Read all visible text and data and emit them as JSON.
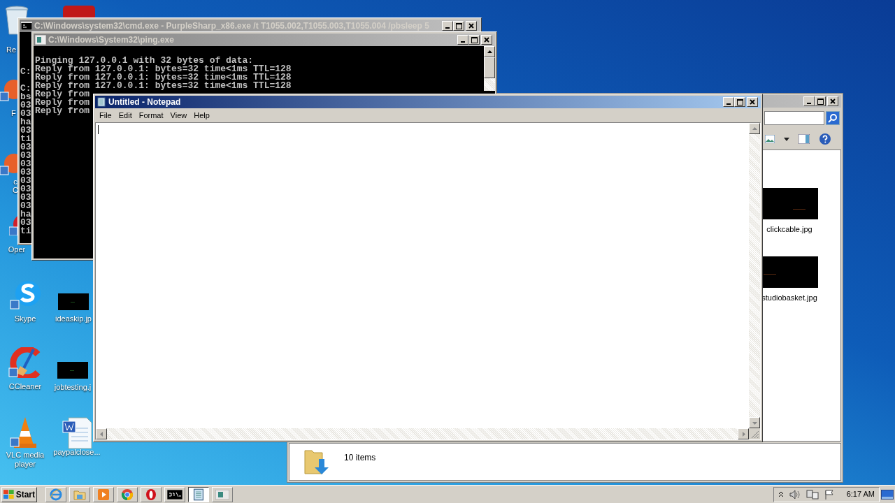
{
  "desktop_icons": [
    {
      "label": "Re",
      "kind": "recycle"
    },
    {
      "label": "F",
      "kind": "shortcut"
    },
    {
      "label": "c C",
      "kind": "shortcut"
    },
    {
      "label": "Oper",
      "kind": "opera"
    },
    {
      "label": "Skype",
      "kind": "skype"
    },
    {
      "label": "ideaskip.jp"
    },
    {
      "label": "CCleaner",
      "kind": "ccleaner"
    },
    {
      "label": "jobtesting.j"
    },
    {
      "label": "VLC media player",
      "kind": "vlc"
    },
    {
      "label": "paypalclose...",
      "kind": "word"
    }
  ],
  "cmd_window": {
    "title": "C:\\Windows\\system32\\cmd.exe - PurpleSharp_x86.exe  /t T1055.002,T1055.003,T1055.004 /pbsleep 5",
    "blocks": [
      [
        "C:"
      ],
      [
        "C:",
        "bs",
        "03",
        "03",
        "ha",
        "03",
        "ti",
        "03",
        "03",
        "03",
        "03",
        "03",
        "03",
        "03",
        "03",
        "ha",
        "03",
        "ti"
      ]
    ]
  },
  "ping_window": {
    "title": "C:\\Windows\\System32\\ping.exe",
    "lines": [
      "Pinging 127.0.0.1 with 32 bytes of data:",
      "Reply from 127.0.0.1: bytes=32 time<1ms TTL=128",
      "Reply from 127.0.0.1: bytes=32 time<1ms TTL=128",
      "Reply from 127.0.0.1: bytes=32 time<1ms TTL=128",
      "Reply from",
      "Reply from",
      "Reply from"
    ]
  },
  "explorer": {
    "files": [
      {
        "name": "clickcable.jpg",
        "kind": "picture"
      },
      {
        "name": "studiobasket.jpg",
        "kind": "picture"
      }
    ],
    "status": "10 items"
  },
  "notepad": {
    "title": "Untitled - Notepad",
    "menu": [
      "File",
      "Edit",
      "Format",
      "View",
      "Help"
    ]
  },
  "taskbar": {
    "start": "Start",
    "apps": [
      {
        "kind": "ie",
        "selected": false
      },
      {
        "kind": "folder",
        "selected": false
      },
      {
        "kind": "media",
        "selected": false
      },
      {
        "kind": "chrome",
        "selected": false
      },
      {
        "kind": "opera",
        "selected": false
      },
      {
        "kind": "console",
        "selected": false
      },
      {
        "kind": "notepad",
        "selected": true
      },
      {
        "kind": "window",
        "selected": false
      }
    ],
    "clock": "6:17 AM"
  }
}
